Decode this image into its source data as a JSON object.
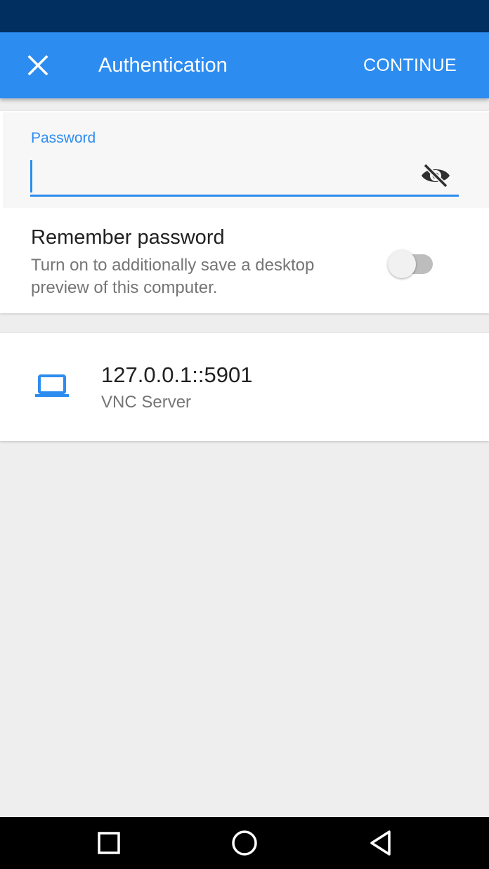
{
  "app_bar": {
    "title": "Authentication",
    "close_icon": "close-icon",
    "continue_label": "CONTINUE",
    "color": "#2d8cef",
    "status_bar_color": "#002f60"
  },
  "password": {
    "label": "Password",
    "value": "",
    "visibility_icon": "eye-off-icon"
  },
  "remember": {
    "title": "Remember password",
    "description": "Turn on to additionally save a desktop preview of this computer.",
    "enabled": false
  },
  "server": {
    "icon": "laptop-icon",
    "address": "127.0.0.1::5901",
    "type": "VNC Server"
  },
  "nav": {
    "recents_icon": "square-icon",
    "home_icon": "circle-icon",
    "back_icon": "triangle-back-icon"
  }
}
